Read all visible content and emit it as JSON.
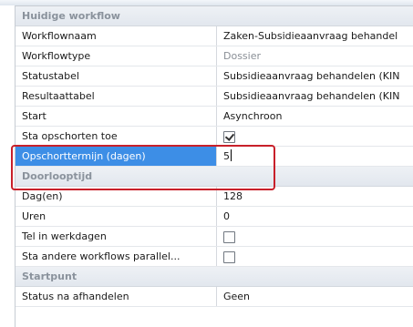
{
  "sections": {
    "current_workflow": "Huidige workflow",
    "lead_time": "Doorlooptijd",
    "starting_point": "Startpunt"
  },
  "workflow": {
    "name_label": "Workflownaam",
    "name_value": "Zaken-Subsidieaanvraag behandel",
    "type_label": "Workflowtype",
    "type_value": "Dossier",
    "status_table_label": "Statustabel",
    "status_table_value": "Subsidieaanvraag behandelen (KIN",
    "result_table_label": "Resultaattabel",
    "result_table_value": "Subsidieaanvraag behandelen (KIN",
    "start_label": "Start",
    "start_value": "Asynchroon",
    "allow_suspend_label": "Sta opschorten toe",
    "allow_suspend_checked": true,
    "suspend_term_label": "Opschorttermijn (dagen)",
    "suspend_term_value": "5"
  },
  "lead_time": {
    "days_label": "Dag(en)",
    "days_value": "128",
    "hours_label": "Uren",
    "hours_value": "0",
    "workdays_label": "Tel in werkdagen",
    "workdays_checked": false,
    "parallel_label": "Sta andere workflows parallel...",
    "parallel_checked": false
  },
  "starting_point": {
    "status_after_label": "Status na afhandelen",
    "status_after_value": "Geen"
  },
  "colors": {
    "selection": "#3d8ee6",
    "highlight_border": "#c8202a",
    "section_text": "#8a929c"
  }
}
